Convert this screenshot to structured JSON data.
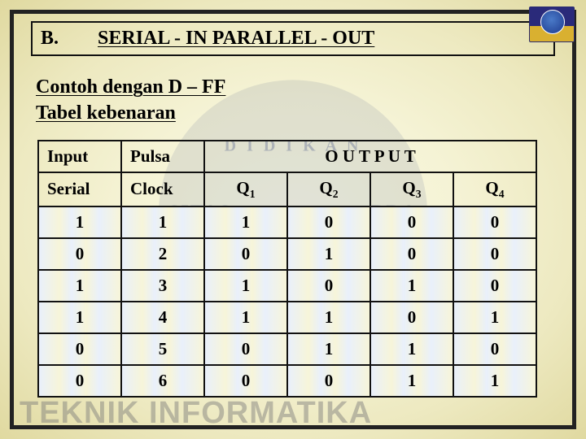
{
  "section_label": "B.",
  "section_title": "SERIAL - IN PARALLEL - OUT",
  "subtitle_line1": "Contoh dengan D – FF",
  "subtitle_line2": "Tabel kebenaran",
  "headers": {
    "input": "Input",
    "pulsa": "Pulsa",
    "output": "O U T P U T",
    "serial": "Serial",
    "clock": "Clock",
    "q1": "Q",
    "q1s": "1",
    "q2": "Q",
    "q2s": "2",
    "q3": "Q",
    "q3s": "3",
    "q4": "Q",
    "q4s": "4"
  },
  "rows": [
    {
      "serial": "1",
      "clock": "1",
      "q1": "1",
      "q2": "0",
      "q3": "0",
      "q4": "0"
    },
    {
      "serial": "0",
      "clock": "2",
      "q1": "0",
      "q2": "1",
      "q3": "0",
      "q4": "0"
    },
    {
      "serial": "1",
      "clock": "3",
      "q1": "1",
      "q2": "0",
      "q3": "1",
      "q4": "0"
    },
    {
      "serial": "1",
      "clock": "4",
      "q1": "1",
      "q2": "1",
      "q3": "0",
      "q4": "1"
    },
    {
      "serial": "0",
      "clock": "5",
      "q1": "0",
      "q2": "1",
      "q3": "1",
      "q4": "0"
    },
    {
      "serial": "0",
      "clock": "6",
      "q1": "0",
      "q2": "0",
      "q3": "1",
      "q4": "1"
    }
  ],
  "watermark_footer": "TEKNIK INFORMATIKA",
  "chart_data": {
    "type": "table",
    "title": "SERIAL - IN PARALLEL - OUT — Tabel kebenaran (D-FF)",
    "columns": [
      "Serial",
      "Clock",
      "Q1",
      "Q2",
      "Q3",
      "Q4"
    ],
    "data": [
      [
        1,
        1,
        1,
        0,
        0,
        0
      ],
      [
        0,
        2,
        0,
        1,
        0,
        0
      ],
      [
        1,
        3,
        1,
        0,
        1,
        0
      ],
      [
        1,
        4,
        1,
        1,
        0,
        1
      ],
      [
        0,
        5,
        0,
        1,
        1,
        0
      ],
      [
        0,
        6,
        0,
        0,
        1,
        1
      ]
    ]
  }
}
